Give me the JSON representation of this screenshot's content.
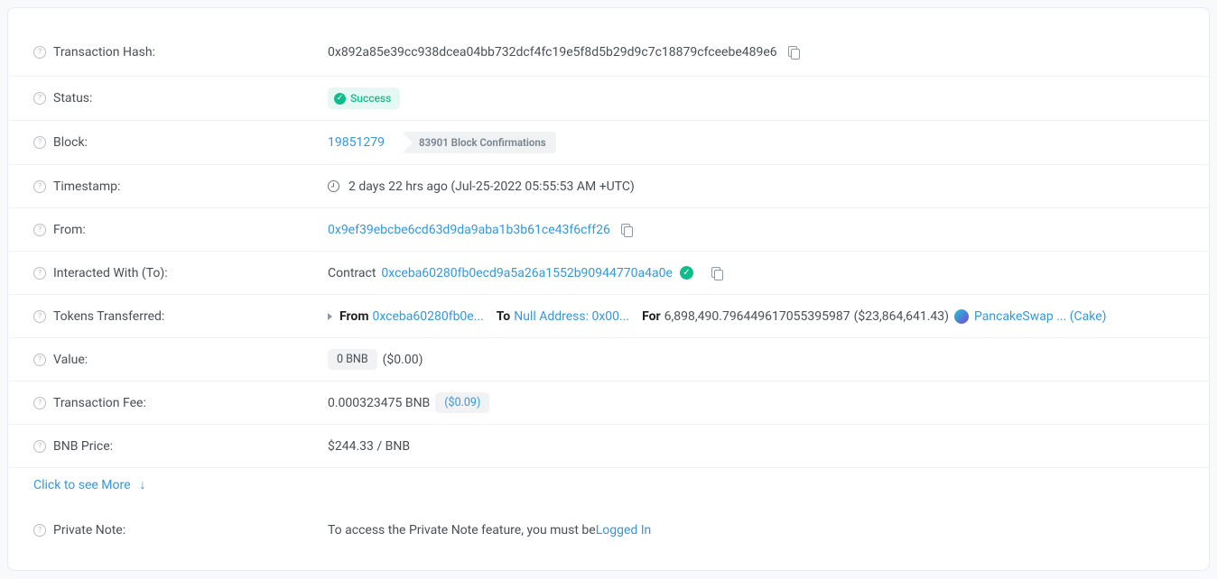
{
  "labels": {
    "txHash": "Transaction Hash:",
    "status": "Status:",
    "block": "Block:",
    "timestamp": "Timestamp:",
    "from": "From:",
    "to": "Interacted With (To):",
    "tokens": "Tokens Transferred:",
    "value": "Value:",
    "fee": "Transaction Fee:",
    "price": "BNB Price:",
    "note": "Private Note:"
  },
  "tx": {
    "hash": "0x892a85e39cc938dcea04bb732dcf4fc19e5f8d5b29d9c7c18879cfceebe489e6",
    "statusText": "Success",
    "block": "19851279",
    "confirmations": "83901 Block Confirmations",
    "timeAgo": "2 days 22 hrs ago (Jul-25-2022 05:55:53 AM +UTC)",
    "from": "0x9ef39ebcbe6cd63d9da9aba1b3b61ce43f6cff26",
    "toPrefix": "Contract",
    "toAddress": "0xceba60280fb0ecd9a5a26a1552b90944770a4a0e",
    "valuePill": "0 BNB",
    "valueUsd": "($0.00)",
    "feeBnb": "0.000323475 BNB",
    "feeUsd": "($0.09)",
    "bnbPrice": "$244.33 / BNB",
    "notePrefix": "To access the Private Note feature, you must be ",
    "noteLink": "Logged In"
  },
  "transfer": {
    "fromLabel": "From",
    "fromAddr": "0xceba60280fb0e...",
    "toLabel": "To",
    "toAddr": "Null Address: 0x00...",
    "forLabel": "For",
    "amount": "6,898,490.796449617055395987",
    "usd": "($23,864,641.43)",
    "tokenName": "PancakeSwap ... (Cake)"
  },
  "more": "Click to see More"
}
